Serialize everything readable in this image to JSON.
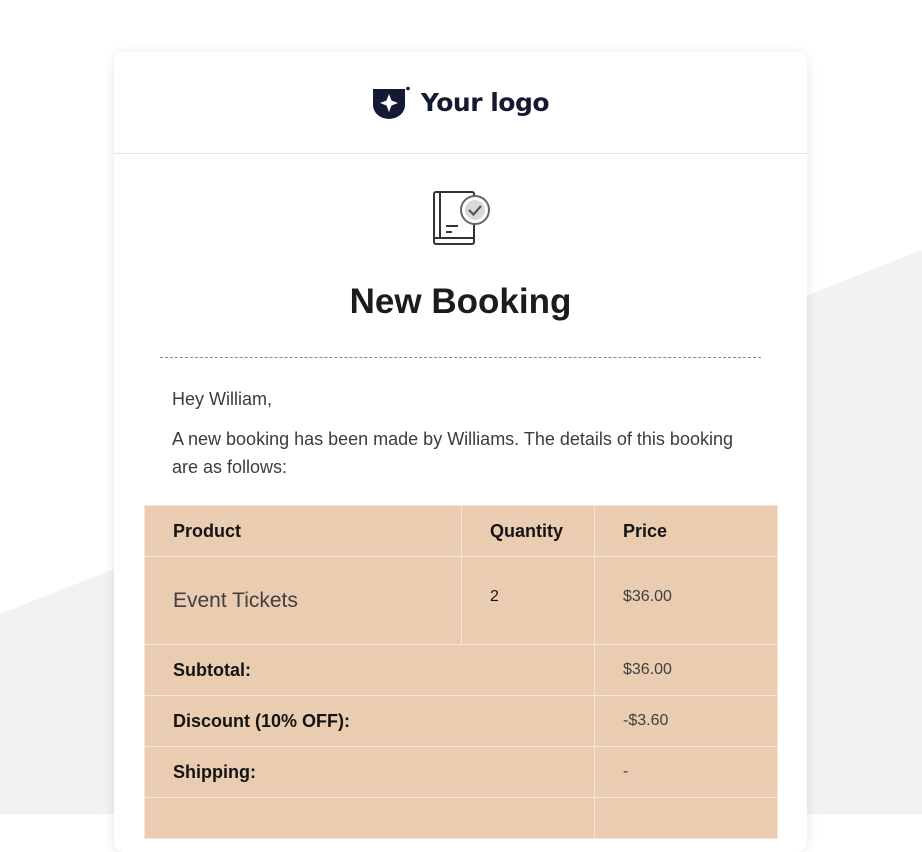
{
  "logo": {
    "text": "Your logo"
  },
  "hero": {
    "icon": "book-check-icon",
    "title": "New Booking"
  },
  "message": {
    "greeting": "Hey William,",
    "intro": "A new booking has been made by Williams. The details of this booking are as follows:"
  },
  "table": {
    "headers": {
      "product": "Product",
      "quantity": "Quantity",
      "price": "Price"
    },
    "items": [
      {
        "product": "Event Tickets",
        "quantity": "2",
        "price": "$36.00"
      }
    ],
    "summary": [
      {
        "label": "Subtotal:",
        "value": "$36.00"
      },
      {
        "label": "Discount (10% OFF):",
        "value": "-$3.60"
      },
      {
        "label": "Shipping:",
        "value": "-"
      }
    ]
  },
  "colors": {
    "table_bg": "#eaccb0",
    "logo": "#141a33",
    "page_shape": "#f2f2f2"
  }
}
